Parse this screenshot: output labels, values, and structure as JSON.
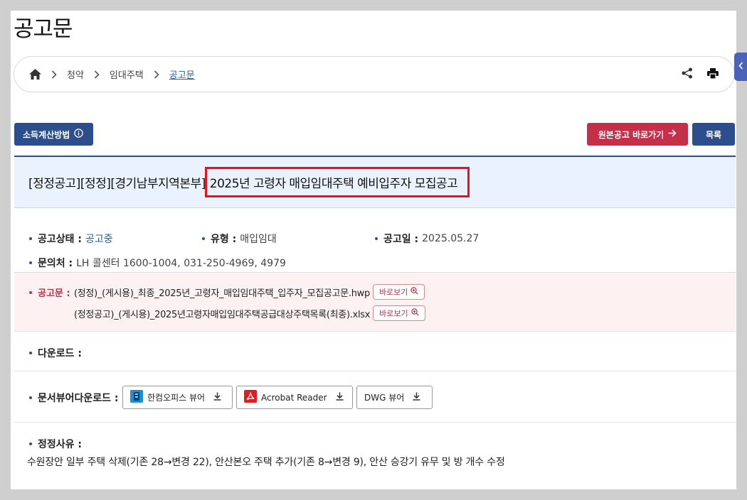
{
  "page": {
    "title": "공고문"
  },
  "breadcrumb": {
    "items": [
      "청약",
      "임대주택"
    ],
    "current": "공고문"
  },
  "buttons": {
    "income_calc": "소득계산방법",
    "original_notice": "원본공고 바로가기",
    "list": "목록"
  },
  "notice": {
    "title_prefix": "[정정공고][정정][경기남부지역본부]",
    "title_main": "2025년 고령자 매입임대주택 예비입주자 모집공고"
  },
  "info": {
    "status_label": "공고상태 :",
    "status_value": "공고중",
    "type_label": "유형 :",
    "type_value": "매입임대",
    "date_label": "공고일 :",
    "date_value": "2025.05.27",
    "contact_label": "문의처 :",
    "contact_value": "LH 콜센터 1600-1004, 031-250-4969, 4979"
  },
  "files": {
    "label": "공고문 :",
    "items": [
      {
        "name": "(정정)_(게시용)_최종_2025년_고령자_매입임대주택_입주자_모집공고문.hwp",
        "view_label": "바로보기"
      },
      {
        "name": "(정정공고)_(게시용)_2025년고령자매입임대주택공급대상주택목록(최종).xlsx",
        "view_label": "바로보기"
      }
    ]
  },
  "download": {
    "label": "다운로드 :"
  },
  "viewers": {
    "label": "문서뷰어다운로드 :",
    "items": [
      {
        "label": "한컴오피스 뷰어",
        "icon": "hancom-icon"
      },
      {
        "label": "Acrobat Reader",
        "icon": "acrobat-icon"
      },
      {
        "label": "DWG 뷰어",
        "icon": ""
      }
    ]
  },
  "reason": {
    "label": "정정사유 :",
    "text": "수원장안 일부 주택 삭제(기존 28→변경 22), 안산본오 주택 추가(기존 8→변경 9), 안산 승강기 유무 및 방 개수 수정"
  },
  "colors": {
    "primary": "#2d4e8c",
    "accent_red": "#c4304a",
    "highlight_box": "#e3141c",
    "title_bg": "#eaf2fd",
    "notice_bg": "#fdf1f2"
  }
}
